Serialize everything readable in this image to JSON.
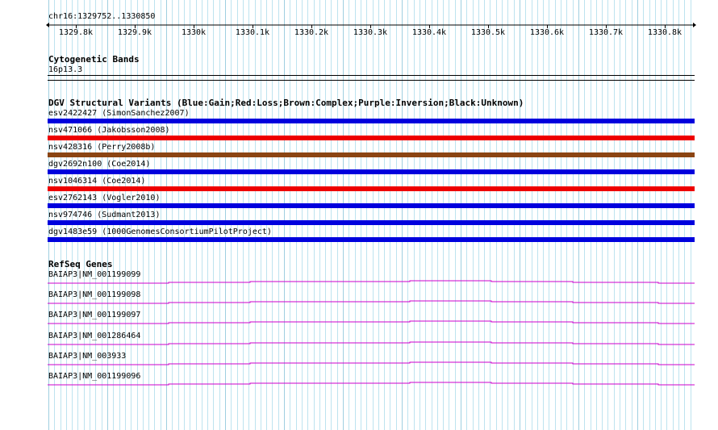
{
  "ruler": {
    "coords": "chr16:1329752..1330850",
    "tick_labels": [
      "1329.8k",
      "1329.9k",
      "1330k",
      "1330.1k",
      "1330.2k",
      "1330.3k",
      "1330.4k",
      "1330.5k",
      "1330.6k",
      "1330.7k",
      "1330.8k"
    ]
  },
  "cytoband": {
    "title": "Cytogenetic Bands",
    "band": "16p13.3"
  },
  "dgv": {
    "title": "DGV Structural Variants (Blue:Gain;Red:Loss;Brown:Complex;Purple:Inversion;Black:Unknown)",
    "colors": {
      "gain": "#0000dd",
      "loss": "#ee0000",
      "complex": "#8b4513"
    },
    "variants": [
      {
        "label": "esv2422427 (SimonSanchez2007)",
        "type": "gain"
      },
      {
        "label": "nsv471066 (Jakobsson2008)",
        "type": "loss"
      },
      {
        "label": "nsv428316 (Perry2008b)",
        "type": "complex"
      },
      {
        "label": "dgv2692n100 (Coe2014)",
        "type": "gain"
      },
      {
        "label": "nsv1046314 (Coe2014)",
        "type": "loss"
      },
      {
        "label": "esv2762143 (Vogler2010)",
        "type": "gain"
      },
      {
        "label": "nsv974746 (Sudmant2013)",
        "type": "gain"
      },
      {
        "label": "dgv1483e59 (1000GenomesConsortiumPilotProject)",
        "type": "gain"
      }
    ]
  },
  "refseq": {
    "title": "RefSeq Genes",
    "gene_color": "#cc00cc",
    "genes": [
      {
        "label": "BAIAP3|NM_001199099"
      },
      {
        "label": "BAIAP3|NM_001199098"
      },
      {
        "label": "BAIAP3|NM_001199097"
      },
      {
        "label": "BAIAP3|NM_001286464"
      },
      {
        "label": "BAIAP3|NM_003933"
      },
      {
        "label": "BAIAP3|NM_001199096"
      }
    ]
  }
}
